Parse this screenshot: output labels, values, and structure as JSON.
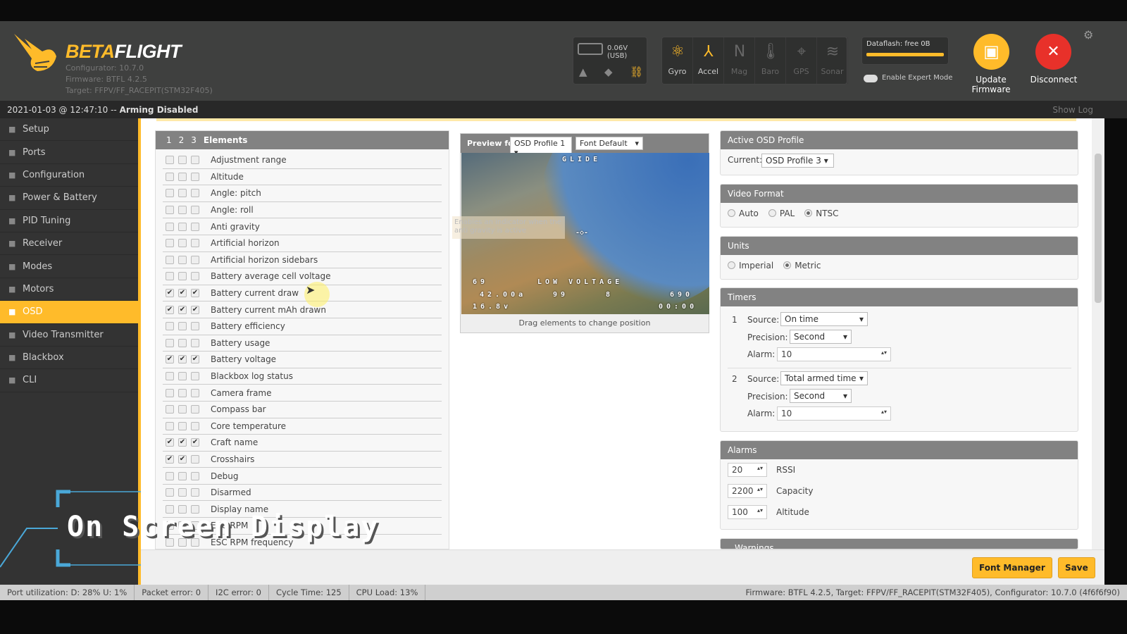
{
  "app": {
    "name_a": "BETA",
    "name_b": "FLIGHT",
    "configurator": "Configurator: 10.7.0",
    "firmware": "Firmware: BTFL 4.2.5",
    "target": "Target: FFPV/FF_RACEPIT(STM32F405)"
  },
  "header": {
    "battery": "0.06V (USB)",
    "sensors": [
      {
        "label": "Gyro",
        "active": true,
        "icon": "gyro-icon"
      },
      {
        "label": "Accel",
        "active": true,
        "icon": "accel-icon"
      },
      {
        "label": "Mag",
        "active": false,
        "icon": "mag-icon"
      },
      {
        "label": "Baro",
        "active": false,
        "icon": "baro-icon"
      },
      {
        "label": "GPS",
        "active": false,
        "icon": "gps-icon"
      },
      {
        "label": "Sonar",
        "active": false,
        "icon": "sonar-icon"
      }
    ],
    "dataflash": "Dataflash: free 0B",
    "expert_mode": "Enable Expert Mode",
    "update_firmware": "Update Firmware",
    "disconnect": "Disconnect",
    "accent": "#ffbb2a",
    "disconnect_color": "#e8312a"
  },
  "status": {
    "time": "2021-01-03 @ 12:47:10 -- ",
    "arming": "Arming Disabled",
    "show_log": "Show Log"
  },
  "sidebar": {
    "active": "OSD",
    "items": [
      {
        "label": "Setup",
        "icon": "wrench-icon"
      },
      {
        "label": "Ports",
        "icon": "plug-icon"
      },
      {
        "label": "Configuration",
        "icon": "gear-icon"
      },
      {
        "label": "Power & Battery",
        "icon": "battery-icon"
      },
      {
        "label": "PID Tuning",
        "icon": "sliders-icon"
      },
      {
        "label": "Receiver",
        "icon": "receiver-icon"
      },
      {
        "label": "Modes",
        "icon": "modes-icon"
      },
      {
        "label": "Motors",
        "icon": "motor-icon"
      },
      {
        "label": "OSD",
        "icon": "osd-icon"
      },
      {
        "label": "Video Transmitter",
        "icon": "vtx-icon"
      },
      {
        "label": "Blackbox",
        "icon": "blackbox-icon"
      },
      {
        "label": "CLI",
        "icon": "terminal-icon"
      }
    ]
  },
  "elements": {
    "tabs": [
      "1",
      "2",
      "3"
    ],
    "title": "Elements",
    "items": [
      {
        "label": "Adjustment range",
        "c": [
          0,
          0,
          0
        ]
      },
      {
        "label": "Altitude",
        "c": [
          0,
          0,
          0
        ]
      },
      {
        "label": "Angle: pitch",
        "c": [
          0,
          0,
          0
        ]
      },
      {
        "label": "Angle: roll",
        "c": [
          0,
          0,
          0
        ]
      },
      {
        "label": "Anti gravity",
        "c": [
          0,
          0,
          0
        ]
      },
      {
        "label": "Artificial horizon",
        "c": [
          0,
          0,
          0
        ]
      },
      {
        "label": "Artificial horizon sidebars",
        "c": [
          0,
          0,
          0
        ]
      },
      {
        "label": "Battery average cell voltage",
        "c": [
          0,
          0,
          0
        ]
      },
      {
        "label": "Battery current draw",
        "c": [
          1,
          1,
          1
        ]
      },
      {
        "label": "Battery current mAh drawn",
        "c": [
          1,
          1,
          1
        ]
      },
      {
        "label": "Battery efficiency",
        "c": [
          0,
          0,
          0
        ]
      },
      {
        "label": "Battery usage",
        "c": [
          0,
          0,
          0
        ]
      },
      {
        "label": "Battery voltage",
        "c": [
          1,
          1,
          1
        ]
      },
      {
        "label": "Blackbox log status",
        "c": [
          0,
          0,
          0
        ]
      },
      {
        "label": "Camera frame",
        "c": [
          0,
          0,
          0
        ]
      },
      {
        "label": "Compass bar",
        "c": [
          0,
          0,
          0
        ]
      },
      {
        "label": "Core temperature",
        "c": [
          0,
          0,
          0
        ]
      },
      {
        "label": "Craft name",
        "c": [
          1,
          1,
          1
        ]
      },
      {
        "label": "Crosshairs",
        "c": [
          1,
          1,
          0
        ]
      },
      {
        "label": "Debug",
        "c": [
          0,
          0,
          0
        ]
      },
      {
        "label": "Disarmed",
        "c": [
          0,
          0,
          0
        ]
      },
      {
        "label": "Display name",
        "c": [
          0,
          0,
          0
        ]
      },
      {
        "label": "ESC RPM",
        "c": [
          0,
          0,
          0
        ]
      },
      {
        "label": "ESC RPM frequency",
        "c": [
          0,
          0,
          0
        ]
      }
    ]
  },
  "preview": {
    "label": "Preview for",
    "profile": "OSD Profile 1",
    "font": "Font Default",
    "hint": "Drag elements to change position",
    "tooltip": "Enables an indicator when the anti gravity is active",
    "osd": {
      "craft": "GLIDE",
      "warning": "LOW VOLTAGE",
      "rssi": "69",
      "current": "42.00a",
      "link": "99",
      "lq": "8",
      "voltage": "16.8v",
      "mah": "690",
      "timer": "00:00"
    }
  },
  "active_profile": {
    "title": "Active OSD Profile",
    "current_label": "Current:",
    "current": "OSD Profile 3"
  },
  "video_format": {
    "title": "Video Format",
    "options": [
      "Auto",
      "PAL",
      "NTSC"
    ],
    "selected": "NTSC"
  },
  "units": {
    "title": "Units",
    "options": [
      "Imperial",
      "Metric"
    ],
    "selected": "Metric"
  },
  "timers": {
    "title": "Timers",
    "source_label": "Source:",
    "precision_label": "Precision:",
    "alarm_label": "Alarm:",
    "items": [
      {
        "n": "1",
        "source": "On time",
        "precision": "Second",
        "alarm": "10"
      },
      {
        "n": "2",
        "source": "Total armed time",
        "precision": "Second",
        "alarm": "10"
      }
    ]
  },
  "alarms": {
    "title": "Alarms",
    "items": [
      {
        "value": "20",
        "label": "RSSI"
      },
      {
        "value": "2200",
        "label": "Capacity"
      },
      {
        "value": "100",
        "label": "Altitude"
      }
    ]
  },
  "warnings": {
    "title": "Warnings"
  },
  "toolbar": {
    "font_manager": "Font Manager",
    "save": "Save"
  },
  "overlay": {
    "title": "On Screen Display"
  },
  "footer": {
    "items": [
      "Port utilization: D: 28% U: 1%",
      "Packet error: 0",
      "I2C error: 0",
      "Cycle Time: 125",
      "CPU Load: 13%"
    ],
    "right": "Firmware: BTFL 4.2.5, Target: FFPV/FF_RACEPIT(STM32F405), Configurator: 10.7.0 (4f6f6f90)"
  }
}
